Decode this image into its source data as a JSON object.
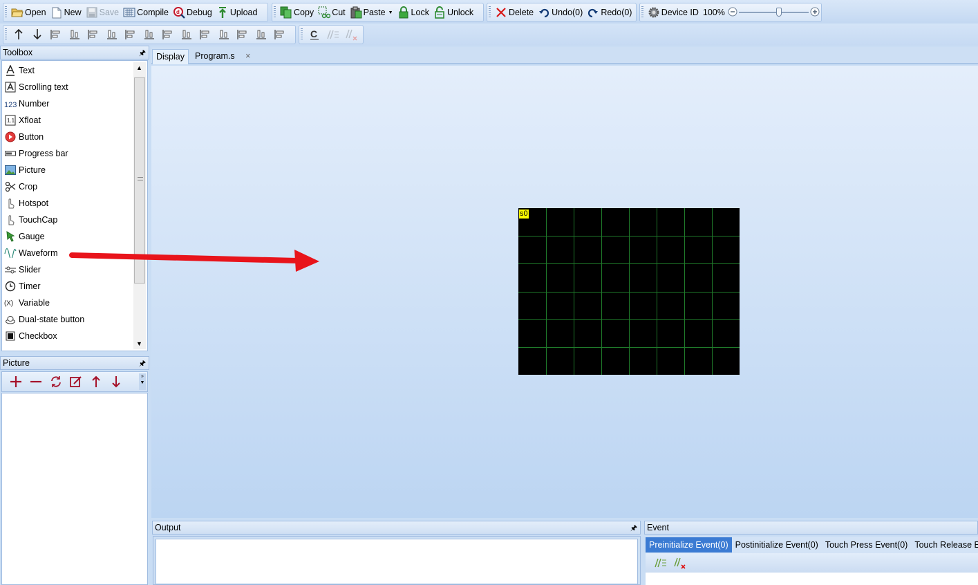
{
  "toolbar_main": [
    {
      "label": "Open",
      "icon": "folder-open-icon"
    },
    {
      "label": "New",
      "icon": "new-file-icon"
    },
    {
      "label": "Save",
      "icon": "save-icon",
      "disabled": true
    },
    {
      "label": "Compile",
      "icon": "compile-icon"
    },
    {
      "label": "Debug",
      "icon": "debug-icon"
    },
    {
      "label": "Upload",
      "icon": "upload-icon"
    }
  ],
  "toolbar_edit": [
    {
      "label": "Copy",
      "icon": "copy-icon"
    },
    {
      "label": "Cut",
      "icon": "cut-icon"
    },
    {
      "label": "Paste",
      "icon": "paste-icon",
      "dropdown": true
    },
    {
      "label": "Lock",
      "icon": "lock-icon"
    },
    {
      "label": "Unlock",
      "icon": "unlock-icon"
    }
  ],
  "toolbar_history": [
    {
      "label": "Delete",
      "icon": "delete-icon"
    },
    {
      "label": "Undo(0)",
      "icon": "undo-icon"
    },
    {
      "label": "Redo(0)",
      "icon": "redo-icon"
    }
  ],
  "toolbar_device": {
    "device_label": "Device ID",
    "zoom_text": "100%",
    "zoom_value": 0.52
  },
  "toolbar_align_icons": [
    "move-up-icon",
    "move-down-icon",
    "align-left-icon",
    "align-right-icon",
    "align-top-icon",
    "align-bottom-icon",
    "center-horizontal-icon",
    "center-vertical-icon",
    "fit-size-icon",
    "distribute-horizontal-icon",
    "increase-h-spacing-icon",
    "decrease-h-spacing-icon",
    "distribute-vertical-icon",
    "increase-v-spacing-icon",
    "decrease-v-spacing-icon"
  ],
  "toolbar_comment_icons": [
    "comment-c-icon",
    "comment-lines-icon",
    "uncomment-lines-icon"
  ],
  "toolbox": {
    "title": "Toolbox",
    "items": [
      {
        "label": "Text",
        "icon": "text-icon"
      },
      {
        "label": "Scrolling text",
        "icon": "scrolling-text-icon"
      },
      {
        "label": "Number",
        "icon": "number-icon"
      },
      {
        "label": "Xfloat",
        "icon": "xfloat-icon"
      },
      {
        "label": "Button",
        "icon": "button-icon"
      },
      {
        "label": "Progress bar",
        "icon": "progress-bar-icon"
      },
      {
        "label": "Picture",
        "icon": "picture-icon"
      },
      {
        "label": "Crop",
        "icon": "crop-icon"
      },
      {
        "label": "Hotspot",
        "icon": "hotspot-icon"
      },
      {
        "label": "TouchCap",
        "icon": "touchcap-icon"
      },
      {
        "label": "Gauge",
        "icon": "gauge-icon"
      },
      {
        "label": "Waveform",
        "icon": "waveform-icon"
      },
      {
        "label": "Slider",
        "icon": "slider-icon"
      },
      {
        "label": "Timer",
        "icon": "timer-icon"
      },
      {
        "label": "Variable",
        "icon": "variable-icon"
      },
      {
        "label": "Dual-state button",
        "icon": "dual-state-button-icon"
      },
      {
        "label": "Checkbox",
        "icon": "checkbox-icon"
      }
    ]
  },
  "picture_panel": {
    "title": "Picture",
    "tools": [
      "add-icon",
      "remove-icon",
      "replace-icon",
      "edit-icon",
      "move-up-icon",
      "move-down-icon"
    ]
  },
  "tabs": [
    {
      "label": "Display",
      "active": true
    },
    {
      "label": "Program.s",
      "closable": true,
      "close_glyph": "×"
    }
  ],
  "canvas": {
    "component_label": "s0",
    "grid_color": "#1f7a2a",
    "grid_columns": 8,
    "grid_rows": 6,
    "arrow_color": "#e8141b"
  },
  "output_panel": {
    "title": "Output"
  },
  "event_panel": {
    "title": "Event",
    "tabs": [
      {
        "label": "Preinitialize Event(0)",
        "active": true
      },
      {
        "label": "Postinitialize Event(0)"
      },
      {
        "label": "Touch Press Event(0)"
      },
      {
        "label": "Touch Release E"
      }
    ],
    "tools": [
      "comment-lines-icon",
      "uncomment-lines-icon"
    ]
  },
  "colors": {
    "active_tab": "#3b7bd3",
    "accent_red": "#e8141b",
    "toolbar_bg": "#d6e5f7"
  }
}
